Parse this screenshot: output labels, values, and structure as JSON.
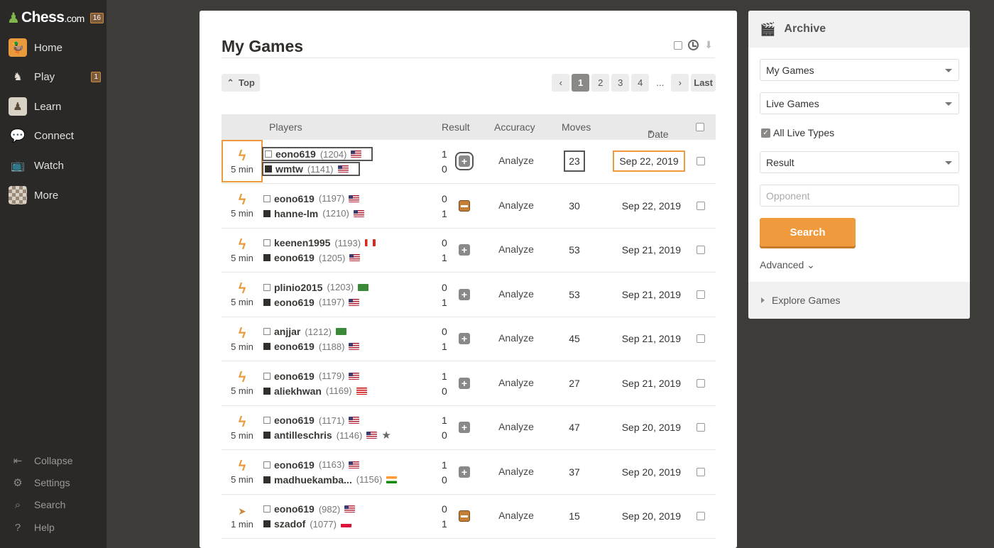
{
  "sidebar": {
    "brand": "Chess",
    "brand_suffix": ".com",
    "brand_badge": "16",
    "items": [
      {
        "label": "Home",
        "icon": "duck-avatar-icon",
        "badge": ""
      },
      {
        "label": "Play",
        "icon": "play-icon",
        "badge": "1"
      },
      {
        "label": "Learn",
        "icon": "learn-icon",
        "badge": ""
      },
      {
        "label": "Connect",
        "icon": "chat-icon",
        "badge": ""
      },
      {
        "label": "Watch",
        "icon": "tv-icon",
        "badge": ""
      },
      {
        "label": "More",
        "icon": "grid-icon",
        "badge": ""
      }
    ],
    "bottom": [
      {
        "label": "Collapse",
        "icon": "collapse-icon"
      },
      {
        "label": "Settings",
        "icon": "gear-icon"
      },
      {
        "label": "Search",
        "icon": "search-icon"
      },
      {
        "label": "Help",
        "icon": "help-icon"
      }
    ]
  },
  "main": {
    "title": "My Games",
    "top_label": "Top",
    "pager": {
      "prev": "‹",
      "pages": [
        "1",
        "2",
        "3",
        "4"
      ],
      "ellipsis": "...",
      "next": "›",
      "last": "Last"
    },
    "columns": {
      "players": "Players",
      "result": "Result",
      "accuracy": "Accuracy",
      "moves": "Moves",
      "date": "Date"
    },
    "rows": [
      {
        "tc": "5 min",
        "type": "bolt",
        "white": {
          "name": "eono619",
          "rating": "(1204)"
        },
        "black": {
          "name": "wmtw",
          "rating": "(1141)"
        },
        "ws": "1",
        "bs": "0",
        "res": "win",
        "analyze": "Analyze",
        "moves": "23",
        "date": "Sep 22, 2019"
      },
      {
        "tc": "5 min",
        "type": "bolt",
        "white": {
          "name": "eono619",
          "rating": "(1197)"
        },
        "black": {
          "name": "hanne-lm",
          "rating": "(1210)"
        },
        "ws": "0",
        "bs": "1",
        "res": "loss",
        "analyze": "Analyze",
        "moves": "30",
        "date": "Sep 22, 2019"
      },
      {
        "tc": "5 min",
        "type": "bolt",
        "white": {
          "name": "keenen1995",
          "rating": "(1193)"
        },
        "black": {
          "name": "eono619",
          "rating": "(1205)"
        },
        "ws": "0",
        "bs": "1",
        "res": "win",
        "analyze": "Analyze",
        "moves": "53",
        "date": "Sep 21, 2019"
      },
      {
        "tc": "5 min",
        "type": "bolt",
        "white": {
          "name": "plinio2015",
          "rating": "(1203)"
        },
        "black": {
          "name": "eono619",
          "rating": "(1197)"
        },
        "ws": "0",
        "bs": "1",
        "res": "win",
        "analyze": "Analyze",
        "moves": "53",
        "date": "Sep 21, 2019"
      },
      {
        "tc": "5 min",
        "type": "bolt",
        "white": {
          "name": "anjjar",
          "rating": "(1212)"
        },
        "black": {
          "name": "eono619",
          "rating": "(1188)"
        },
        "ws": "0",
        "bs": "1",
        "res": "win",
        "analyze": "Analyze",
        "moves": "45",
        "date": "Sep 21, 2019"
      },
      {
        "tc": "5 min",
        "type": "bolt",
        "white": {
          "name": "eono619",
          "rating": "(1179)"
        },
        "black": {
          "name": "aliekhwan",
          "rating": "(1169)"
        },
        "ws": "1",
        "bs": "0",
        "res": "win",
        "analyze": "Analyze",
        "moves": "27",
        "date": "Sep 21, 2019"
      },
      {
        "tc": "5 min",
        "type": "bolt",
        "white": {
          "name": "eono619",
          "rating": "(1171)"
        },
        "black": {
          "name": "antilleschris",
          "rating": "(1146)"
        },
        "ws": "1",
        "bs": "0",
        "res": "win",
        "analyze": "Analyze",
        "moves": "47",
        "date": "Sep 20, 2019"
      },
      {
        "tc": "5 min",
        "type": "bolt",
        "white": {
          "name": "eono619",
          "rating": "(1163)"
        },
        "black": {
          "name": "madhuekamba...",
          "rating": "(1156)"
        },
        "ws": "1",
        "bs": "0",
        "res": "win",
        "analyze": "Analyze",
        "moves": "37",
        "date": "Sep 20, 2019"
      },
      {
        "tc": "1 min",
        "type": "bullet",
        "white": {
          "name": "eono619",
          "rating": "(982)"
        },
        "black": {
          "name": "szadof",
          "rating": "(1077)"
        },
        "ws": "0",
        "bs": "1",
        "res": "loss",
        "analyze": "Analyze",
        "moves": "15",
        "date": "Sep 20, 2019"
      }
    ]
  },
  "archive": {
    "title": "Archive",
    "games_select": "My Games",
    "type_select": "Live Games",
    "all_live_types": "All Live Types",
    "result_select": "Result",
    "opponent_placeholder": "Opponent",
    "search_label": "Search",
    "advanced_label": "Advanced ⌄",
    "explore_label": "Explore Games"
  },
  "colors": {
    "accent": "#ef9a3c",
    "sidebar_bg": "#2a2927",
    "page_bg": "#3d3c39"
  }
}
